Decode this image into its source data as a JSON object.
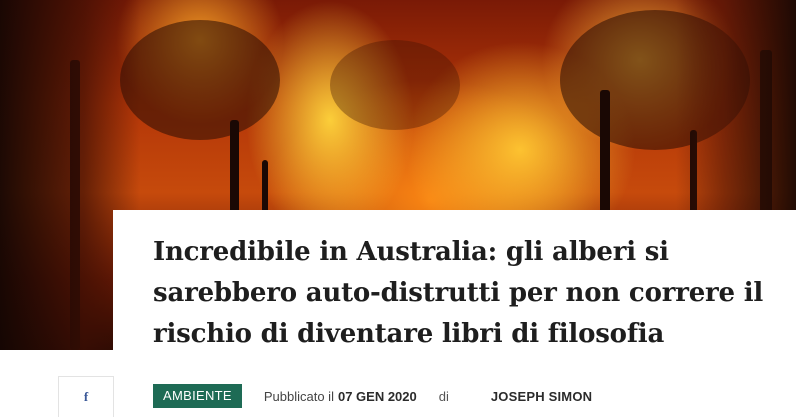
{
  "article": {
    "title": "Incredibile in Australia: gli alberi si sarebbero auto-distrutti per non correre il rischio di diventare libri di filosofia",
    "category": "AMBIENTE",
    "published_prefix": "Pubblicato il",
    "date": "07 GEN 2020",
    "by_label": "di",
    "author": "JOSEPH SIMON"
  },
  "share": {
    "facebook_icon": "facebook-icon",
    "facebook_glyph": "f"
  },
  "colors": {
    "badge_bg": "#1e6b55",
    "facebook": "#3b5998"
  }
}
